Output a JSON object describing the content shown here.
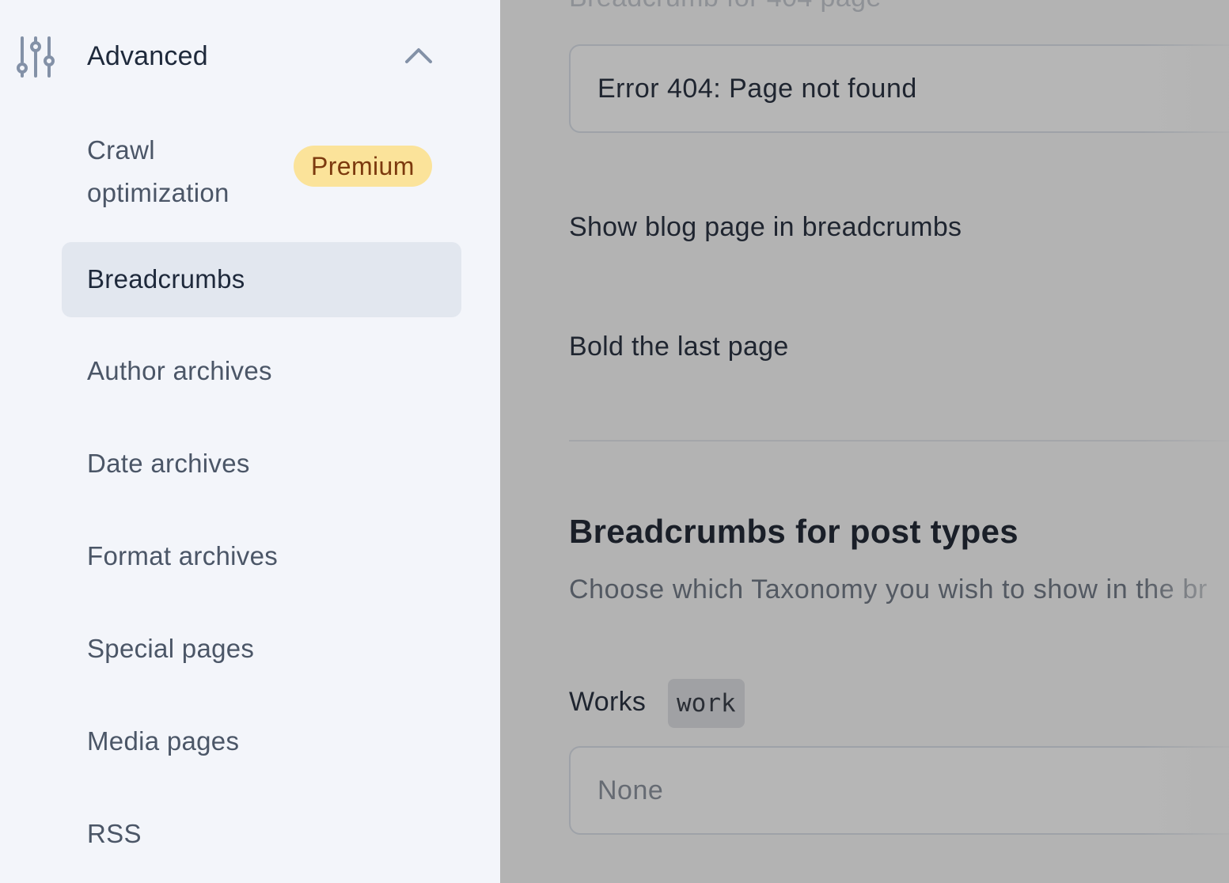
{
  "sidebar": {
    "section": {
      "icon": "sliders-icon",
      "title": "Advanced",
      "toggle_icon": "chevron-up-icon"
    },
    "items": [
      {
        "label": "Crawl optimization",
        "badge": "Premium"
      },
      {
        "label": "Breadcrumbs",
        "active": true
      },
      {
        "label": "Author archives"
      },
      {
        "label": "Date archives"
      },
      {
        "label": "Format archives"
      },
      {
        "label": "Special pages"
      },
      {
        "label": "Media pages"
      },
      {
        "label": "RSS"
      }
    ]
  },
  "main": {
    "cut_label": "Breadcrumb for 404 page",
    "field_404_value": "Error 404: Page not found",
    "toggles": [
      {
        "label": "Show blog page in breadcrumbs"
      },
      {
        "label": "Bold the last page"
      }
    ],
    "post_types_section": {
      "heading": "Breadcrumbs for post types",
      "description": "Choose which Taxonomy you wish to show in the br",
      "post_type": {
        "label": "Works",
        "slug": "work",
        "select_value": "None"
      }
    }
  },
  "colors": {
    "sidebar_bg": "#f3f5fa",
    "active_item_bg": "#e2e7ef",
    "badge_bg": "#fbe39a",
    "badge_text": "#7c3a0e",
    "overlay": "#b3b3b3"
  }
}
